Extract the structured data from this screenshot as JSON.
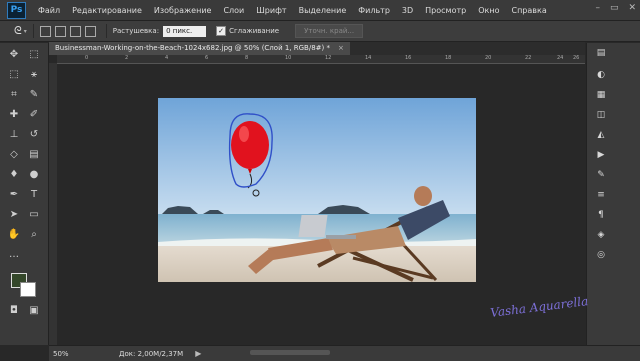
{
  "app": {
    "logo": "Ps"
  },
  "menu": [
    "Файл",
    "Редактирование",
    "Изображение",
    "Слои",
    "Шрифт",
    "Выделение",
    "Фильтр",
    "3D",
    "Просмотр",
    "Окно",
    "Справка"
  ],
  "window_controls": {
    "minimize": "–",
    "restore": "▭",
    "close": "✕"
  },
  "options_bar": {
    "feather_label": "Растушевка:",
    "feather_value": "0 пикс.",
    "antialias_label": "Сглаживание",
    "refine_button": "Уточн. край..."
  },
  "document": {
    "tab_title": "Businessman-Working-on-the-Beach-1024x682.jpg @ 50% (Слой 1, RGB/8#) *",
    "close": "×"
  },
  "ruler": {
    "marks": [
      "0",
      "2",
      "4",
      "6",
      "8",
      "10",
      "12",
      "14",
      "16",
      "18",
      "20",
      "22",
      "24",
      "26"
    ]
  },
  "colors": {
    "foreground": "#34472a",
    "background": "#ffffff",
    "accent": "#1c8ed6"
  },
  "status": {
    "zoom": "50%",
    "doc_size": "Док: 2,00M/2,37M",
    "arrow": "▶"
  },
  "signature": "Vasha Aquarella"
}
